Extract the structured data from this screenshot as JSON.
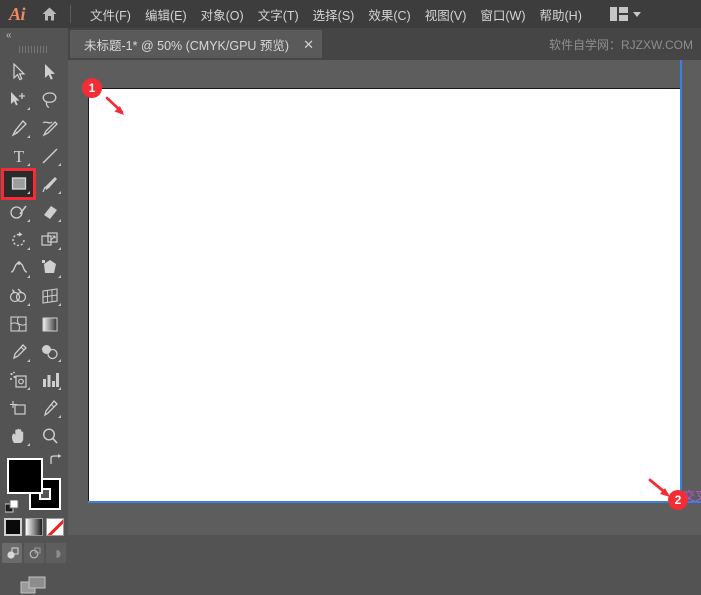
{
  "app": {
    "name": "Ai",
    "logo_color": "#ee8b62"
  },
  "menubar": {
    "home_icon": "home-icon",
    "items": [
      {
        "label": "文件(F)"
      },
      {
        "label": "编辑(E)"
      },
      {
        "label": "对象(O)"
      },
      {
        "label": "文字(T)"
      },
      {
        "label": "选择(S)"
      },
      {
        "label": "效果(C)"
      },
      {
        "label": "视图(V)"
      },
      {
        "label": "窗口(W)"
      },
      {
        "label": "帮助(H)"
      }
    ],
    "workspace_icon": "workspace-layout-icon",
    "workspace_chevron": "chevron-down-icon"
  },
  "tabbar": {
    "tab_title": "未标题-1* @ 50% (CMYK/GPU 预览)",
    "close_label": "✕",
    "watermark": "软件自学网：RJZXW.COM"
  },
  "toolbar": {
    "collapse_label": "«",
    "grip": "drag-grip",
    "tools": [
      {
        "name": "selection-tool",
        "corner": false
      },
      {
        "name": "direct-selection-tool",
        "corner": false
      },
      {
        "name": "magic-wand-tool",
        "corner": true
      },
      {
        "name": "lasso-tool",
        "corner": false
      },
      {
        "name": "pen-tool",
        "corner": true
      },
      {
        "name": "curvature-tool",
        "corner": false
      },
      {
        "name": "type-tool",
        "corner": true
      },
      {
        "name": "line-segment-tool",
        "corner": true
      },
      {
        "name": "rectangle-tool",
        "corner": true,
        "selected": true,
        "highlighted": true
      },
      {
        "name": "paintbrush-tool",
        "corner": true
      },
      {
        "name": "shaper-tool",
        "corner": true
      },
      {
        "name": "eraser-tool",
        "corner": true
      },
      {
        "name": "rotate-tool",
        "corner": true
      },
      {
        "name": "scale-tool",
        "corner": true
      },
      {
        "name": "width-tool",
        "corner": true
      },
      {
        "name": "free-transform-tool",
        "corner": true
      },
      {
        "name": "shape-builder-tool",
        "corner": true
      },
      {
        "name": "perspective-grid-tool",
        "corner": true
      },
      {
        "name": "mesh-tool",
        "corner": false
      },
      {
        "name": "gradient-tool",
        "corner": false
      },
      {
        "name": "eyedropper-tool",
        "corner": true
      },
      {
        "name": "blend-tool",
        "corner": true
      },
      {
        "name": "symbol-sprayer-tool",
        "corner": true
      },
      {
        "name": "column-graph-tool",
        "corner": true
      },
      {
        "name": "artboard-tool",
        "corner": false
      },
      {
        "name": "slice-tool",
        "corner": true
      },
      {
        "name": "hand-tool",
        "corner": true
      },
      {
        "name": "zoom-tool",
        "corner": false
      }
    ],
    "colors": {
      "fill": "#000000",
      "stroke": "#000000",
      "accent_highlight": "#f42c34"
    },
    "swatches": {
      "fill_name": "fill-color-swatch",
      "stroke_name": "stroke-color-swatch",
      "swap_name": "swap-fill-stroke-icon",
      "default_name": "default-fill-stroke-icon"
    },
    "color_modes": [
      {
        "name": "color-swatch-button"
      },
      {
        "name": "gradient-swatch-button"
      },
      {
        "name": "none-swatch-button"
      }
    ],
    "draw_modes": [
      {
        "name": "draw-normal-button"
      },
      {
        "name": "draw-behind-button"
      },
      {
        "name": "draw-inside-button"
      }
    ],
    "screen_mode": {
      "name": "change-screen-mode-button"
    }
  },
  "canvas": {
    "artboard_background": "#ffffff",
    "canvas_background": "#5d5d5d",
    "guide_color": "#3f7fdf",
    "zoom_level": "50%"
  },
  "annotations": {
    "marker_color": "#f42c34",
    "markers": [
      {
        "id": "annotation-badge-1",
        "label": "1"
      },
      {
        "id": "annotation-badge-2",
        "label": "2"
      }
    ],
    "cross_label": "交叉",
    "cross_color": "#c44fe0"
  }
}
